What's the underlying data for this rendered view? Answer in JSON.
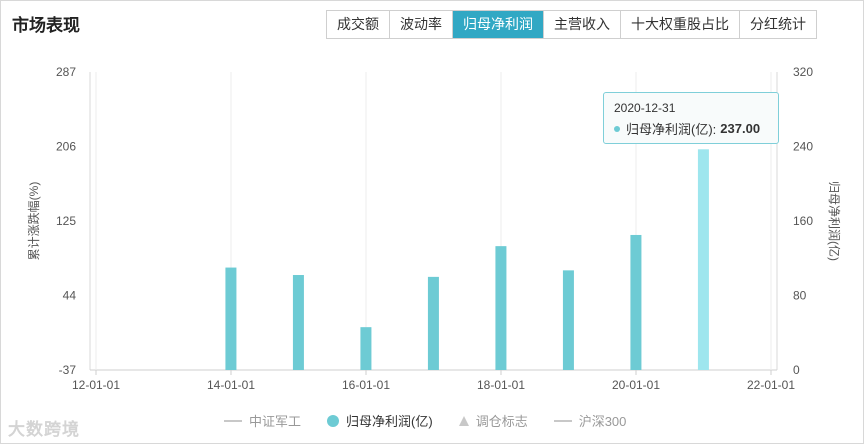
{
  "header": {
    "title": "市场表现",
    "tabs": [
      {
        "label": "成交额",
        "active": false
      },
      {
        "label": "波动率",
        "active": false
      },
      {
        "label": "归母净利润",
        "active": true
      },
      {
        "label": "主营收入",
        "active": false
      },
      {
        "label": "十大权重股占比",
        "active": false
      },
      {
        "label": "分红统计",
        "active": false
      }
    ]
  },
  "chart_data": {
    "type": "bar",
    "series": [
      {
        "name": "归母净利润(亿)",
        "color": "#6dcbd4",
        "highlight_color": "#9ee6ee",
        "points": [
          {
            "x": "2013-12-31",
            "y": 110
          },
          {
            "x": "2014-12-31",
            "y": 102
          },
          {
            "x": "2015-12-31",
            "y": 46
          },
          {
            "x": "2016-12-31",
            "y": 100
          },
          {
            "x": "2017-12-31",
            "y": 133
          },
          {
            "x": "2018-12-31",
            "y": 107
          },
          {
            "x": "2019-12-31",
            "y": 145
          },
          {
            "x": "2020-12-31",
            "y": 237
          }
        ]
      }
    ],
    "x_ticks": [
      "12-01-01",
      "14-01-01",
      "16-01-01",
      "18-01-01",
      "20-01-01",
      "22-01-01"
    ],
    "x_range": [
      "2012-01-01",
      "2022-01-01"
    ],
    "y_left": {
      "label": "累计涨跌幅(%)",
      "ticks": [
        287,
        206,
        125,
        44,
        -37
      ],
      "range": [
        -37,
        287
      ]
    },
    "y_right": {
      "label": "归母净利润(亿)",
      "ticks": [
        320,
        240,
        160,
        80,
        0
      ],
      "range": [
        0,
        320
      ]
    },
    "grid": "vertical",
    "legend_position": "bottom"
  },
  "legend": [
    {
      "label": "中证军工",
      "symbol": "line",
      "active": false
    },
    {
      "label": "归母净利润(亿)",
      "symbol": "dot",
      "active": true
    },
    {
      "label": "调仓标志",
      "symbol": "triangle",
      "active": false
    },
    {
      "label": "沪深300",
      "symbol": "line",
      "active": false
    }
  ],
  "tooltip": {
    "date": "2020-12-31",
    "series": "归母净利润(亿):",
    "value": "237.00"
  },
  "watermark": "大数跨境"
}
